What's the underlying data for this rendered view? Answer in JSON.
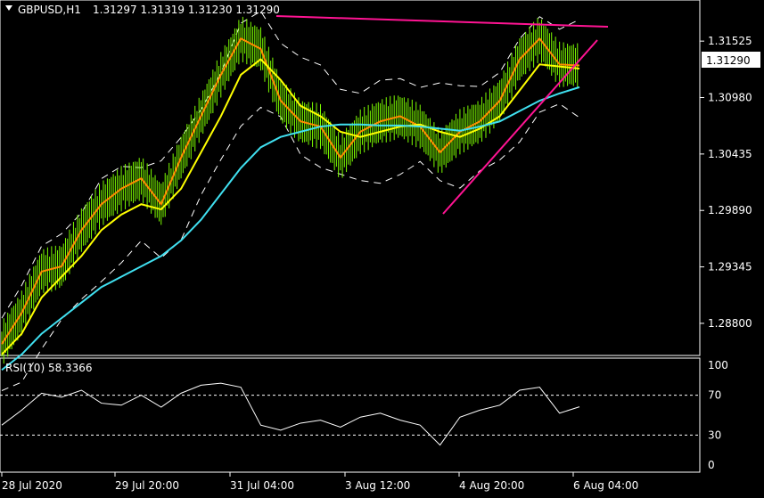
{
  "header": {
    "symbol": "GBPUSD,H1",
    "ohlc": "1.31297 1.31319 1.31230 1.31290"
  },
  "price_scale": {
    "ticks": [
      "1.31525",
      "1.30980",
      "1.30435",
      "1.29890",
      "1.29345",
      "1.28800"
    ],
    "current_price_label": "1.31290"
  },
  "rsi_panel": {
    "label": "RSI(10) 58.3366",
    "ticks": [
      "100",
      "70",
      "30",
      "0"
    ]
  },
  "time_axis": {
    "labels": [
      "28 Jul 2020",
      "29 Jul 20:00",
      "31 Jul 04:00",
      "3 Aug 12:00",
      "4 Aug 20:00",
      "6 Aug 04:00"
    ]
  },
  "colors": {
    "background": "#000000",
    "candles": "#7CFC00",
    "ema_fast": "#FF8C00",
    "ema_slow": "#FFFF00",
    "sma_long": "#40E0F0",
    "bollinger": "#FFFFFF",
    "trendlines": "#FF1493",
    "rsi": "#FFFFFF"
  },
  "chart_data": {
    "type": "line",
    "title": "GBPUSD,H1",
    "x": [
      "28 Jul 2020",
      "29 Jul 20:00",
      "31 Jul 04:00",
      "3 Aug 12:00",
      "4 Aug 20:00",
      "6 Aug 04:00"
    ],
    "ylim": [
      1.2855,
      1.3175
    ],
    "grid": false,
    "series": [
      {
        "values": [
          1.286,
          1.289,
          1.293,
          1.2935,
          1.297,
          1.2995,
          1.301,
          1.302,
          1.2995,
          1.304,
          1.308,
          1.312,
          1.3155,
          1.3145,
          1.3095,
          1.3075,
          1.307,
          1.304,
          1.3065,
          1.3075,
          1.308,
          1.307,
          1.3045,
          1.3065,
          1.3075,
          1.3095,
          1.3135,
          1.3155,
          1.313,
          1.3129
        ]
      },
      {
        "values": [
          1.285,
          1.287,
          1.2905,
          1.2925,
          1.2945,
          1.297,
          1.2985,
          1.2995,
          1.299,
          1.301,
          1.3045,
          1.308,
          1.312,
          1.3135,
          1.3115,
          1.309,
          1.308,
          1.3065,
          1.306,
          1.3065,
          1.307,
          1.3072,
          1.3065,
          1.306,
          1.3068,
          1.308,
          1.3105,
          1.313,
          1.3128,
          1.3126
        ]
      },
      {
        "values": [
          1.2835,
          1.285,
          1.287,
          1.2885,
          1.29,
          1.2915,
          1.2925,
          1.2935,
          1.2945,
          1.296,
          1.298,
          1.3005,
          1.303,
          1.305,
          1.306,
          1.3065,
          1.307,
          1.3072,
          1.3072,
          1.3071,
          1.3071,
          1.307,
          1.3068,
          1.3066,
          1.307,
          1.3075,
          1.3085,
          1.3095,
          1.3102,
          1.3108
        ]
      }
    ],
    "rsi": {
      "ylim": [
        0,
        100
      ],
      "levels": [
        70,
        30
      ],
      "values": [
        40,
        55,
        72,
        68,
        75,
        62,
        60,
        70,
        58,
        72,
        80,
        82,
        78,
        40,
        35,
        42,
        45,
        38,
        48,
        52,
        45,
        40,
        20,
        48,
        55,
        60,
        75,
        78,
        52,
        58.34
      ]
    }
  }
}
